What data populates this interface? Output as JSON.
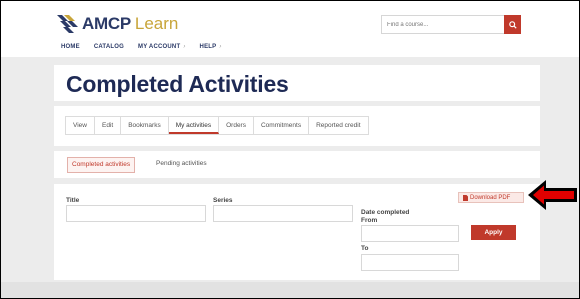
{
  "header": {
    "brand": "AMCP",
    "brand_sub": "Learn",
    "search_placeholder": "Find a course...",
    "nav": [
      {
        "label": "HOME"
      },
      {
        "label": "CATALOG"
      },
      {
        "label": "MY ACCOUNT",
        "caret": "›"
      },
      {
        "label": "HELP",
        "caret": "›"
      }
    ]
  },
  "page": {
    "title": "Completed Activities"
  },
  "tabs": [
    "View",
    "Edit",
    "Bookmarks",
    "My activities",
    "Orders",
    "Commitments",
    "Reported credit"
  ],
  "active_tab": "My activities",
  "subtabs": {
    "active": "Completed activities",
    "inactive": "Pending activities"
  },
  "form": {
    "title_label": "Title",
    "series_label": "Series",
    "date_completed_label": "Date completed",
    "from_label": "From",
    "to_label": "To",
    "download_pdf_label": "Download PDF",
    "apply_label": "Apply"
  },
  "colors": {
    "brand_navy": "#1e2a55",
    "accent_red": "#c0392b",
    "gold": "#c8a53a",
    "annotation_arrow": "#e00000"
  },
  "icons": {
    "logo": "chevron-stack-logo-icon",
    "search": "search-icon",
    "pdf": "file-icon",
    "annotation": "arrow-left-icon"
  }
}
